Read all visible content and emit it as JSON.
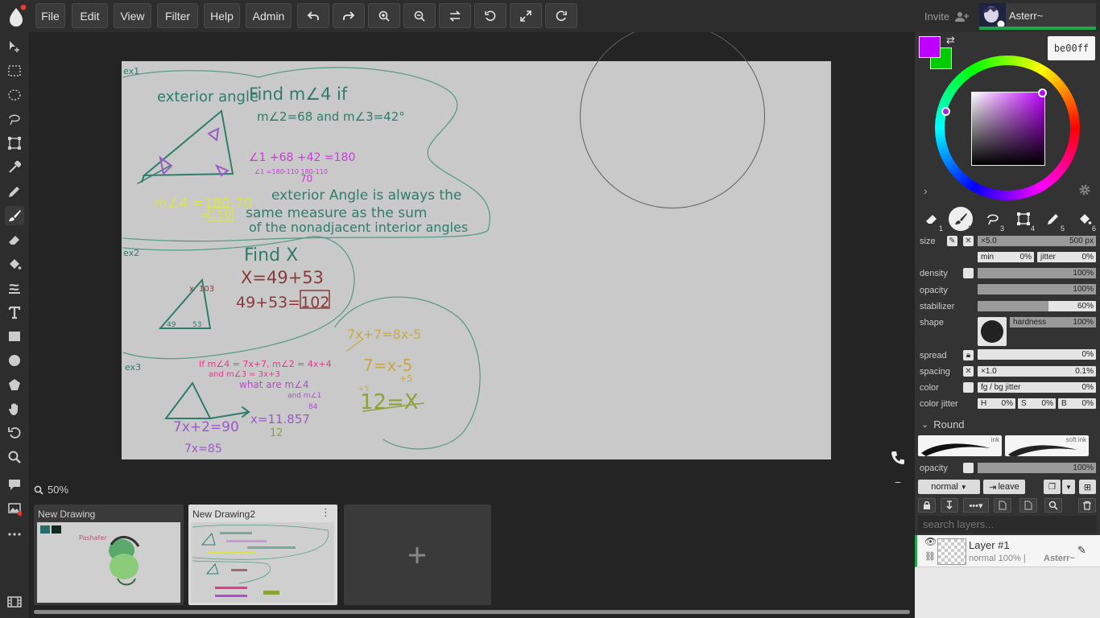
{
  "menu": {
    "file": "File",
    "edit": "Edit",
    "view": "View",
    "filter": "Filter",
    "help": "Help",
    "admin": "Admin"
  },
  "header": {
    "invite": "Invite",
    "username": "Asterr~"
  },
  "colors": {
    "primary": "#be00ff",
    "secondary": "#00cc00",
    "hex_value": "be00ff",
    "accent_green": "#1fa64a"
  },
  "viewport": {
    "zoom": "50%"
  },
  "canvas_text": {
    "ex1": "ex1",
    "ex2": "ex2",
    "ex3": "ex3",
    "ext_angle": "exterior angle",
    "find1": "Find m∠4 if",
    "given1": "m∠2=68 and m∠3=42°",
    "calc1": "∠1 +68 +42 =180",
    "calc1b": "∠1 =180-110  180-110",
    "calc1c": "70",
    "ans1": "m∠4 =180-70",
    "ans1b": "=110",
    "rule1": "exterior Angle is always the",
    "rule2": "same measure as the sum",
    "rule3": "of the nonadjacent interior angles",
    "find2": "Find X",
    "eq2a": "X=49+53",
    "eq2b": "49+53=102",
    "tri2a": "x",
    "tri2b": "103",
    "tri2c": "49",
    "tri2d": "53",
    "eq3a": "7x+7=8x-5",
    "eq3b": "7=x-5",
    "eq3c": "+5",
    "eq3d": "+5",
    "eq3e": "12=X",
    "ex3a": "If m∠4 = 7x+7, m∠2 = 4x+4",
    "ex3b": "and m∠3 = 3x+3",
    "ex3c": "what are m∠4",
    "ex3d": "and m∠1",
    "ex3e": "84",
    "ex3f": "7x+2=90",
    "ex3g": "7x=85",
    "ex3h": "x=11.857",
    "ex3i": "12"
  },
  "documents": [
    {
      "title": "New Drawing",
      "sig": "Pashafer"
    },
    {
      "title": "New Drawing2"
    }
  ],
  "tools": [
    "1",
    "2",
    "3",
    "4",
    "5",
    "6"
  ],
  "brush": {
    "size_label": "size",
    "size_mult": "×5.0",
    "size_value": "500 px",
    "size_pct": 1.0,
    "min_label": "min",
    "min_value": "0%",
    "jitter_label": "jitter",
    "jitter_value": "0%",
    "density_label": "density",
    "density_value": "100%",
    "density_pct": 1.0,
    "opacity_label": "opacity",
    "opacity_value": "100%",
    "opacity_pct": 1.0,
    "stabilizer_label": "stabilizer",
    "stabilizer_value": "60%",
    "stabilizer_pct": 0.6,
    "shape_label": "shape",
    "hardness_label": "hardness",
    "hardness_value": "100%",
    "spread_label": "spread",
    "spread_value": "0%",
    "spacing_label": "spacing",
    "spacing_mult": "×1.0",
    "spacing_value": "0.1%",
    "color_label": "color",
    "color_mode": "fg / bg jitter",
    "color_value": "0%",
    "color_jitter_label": "color jitter",
    "h_label": "H",
    "h_value": "0%",
    "s_label": "S",
    "s_value": "0%",
    "b_label": "B",
    "b_value": "0%"
  },
  "presets": {
    "header": "Round",
    "p1": "ink",
    "p2": "soft ink"
  },
  "layers": {
    "opacity_label": "opacity",
    "opacity_value": "100%",
    "blend_mode": "normal",
    "leave_label": "leave",
    "search_placeholder": "search layers...",
    "items": [
      {
        "name": "Layer #1",
        "meta": "normal 100% |",
        "owner": "Asterr~"
      }
    ]
  }
}
